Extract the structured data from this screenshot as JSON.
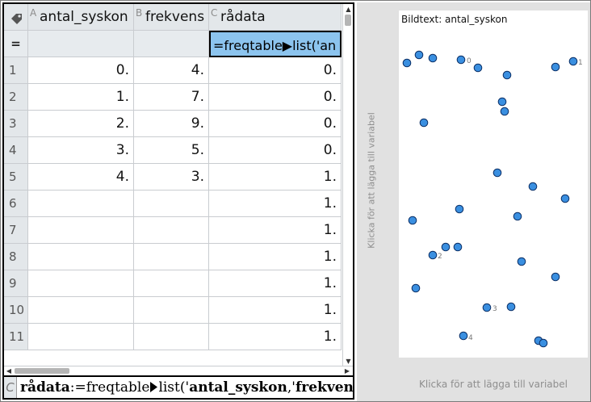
{
  "spreadsheet": {
    "columns": [
      {
        "letter": "A",
        "name": "antal_syskon"
      },
      {
        "letter": "B",
        "name": "frekvens"
      },
      {
        "letter": "C",
        "name": "rådata"
      }
    ],
    "formula_row_marker": "=",
    "formula_cell": "=freqtable▶list('an",
    "rows": [
      {
        "n": "1",
        "a": "0.",
        "b": "4.",
        "c": "0."
      },
      {
        "n": "2",
        "a": "1.",
        "b": "7.",
        "c": "0."
      },
      {
        "n": "3",
        "a": "2.",
        "b": "9.",
        "c": "0."
      },
      {
        "n": "4",
        "a": "3.",
        "b": "5.",
        "c": "0."
      },
      {
        "n": "5",
        "a": "4.",
        "b": "3.",
        "c": "1."
      },
      {
        "n": "6",
        "a": "",
        "b": "",
        "c": "1."
      },
      {
        "n": "7",
        "a": "",
        "b": "",
        "c": "1."
      },
      {
        "n": "8",
        "a": "",
        "b": "",
        "c": "1."
      },
      {
        "n": "9",
        "a": "",
        "b": "",
        "c": "1."
      },
      {
        "n": "10",
        "a": "",
        "b": "",
        "c": "1."
      },
      {
        "n": "11",
        "a": "",
        "b": "",
        "c": "1."
      }
    ],
    "entry_line": {
      "cell_letter": "C",
      "var": "rådata",
      "expr1": ":=freqtable",
      "expr2": "list('",
      "arg1": "antal_syskon",
      "sep": ",'",
      "arg2": "frekvens"
    }
  },
  "graph": {
    "caption": "Bildtext: antal_syskon",
    "y_placeholder": "Klicka för att lägga till variabel",
    "x_placeholder": "Klicka för att lägga till variabel",
    "point_color": "#3a8fe0",
    "labels": [
      "0",
      "1",
      "2",
      "3",
      "4"
    ]
  }
}
